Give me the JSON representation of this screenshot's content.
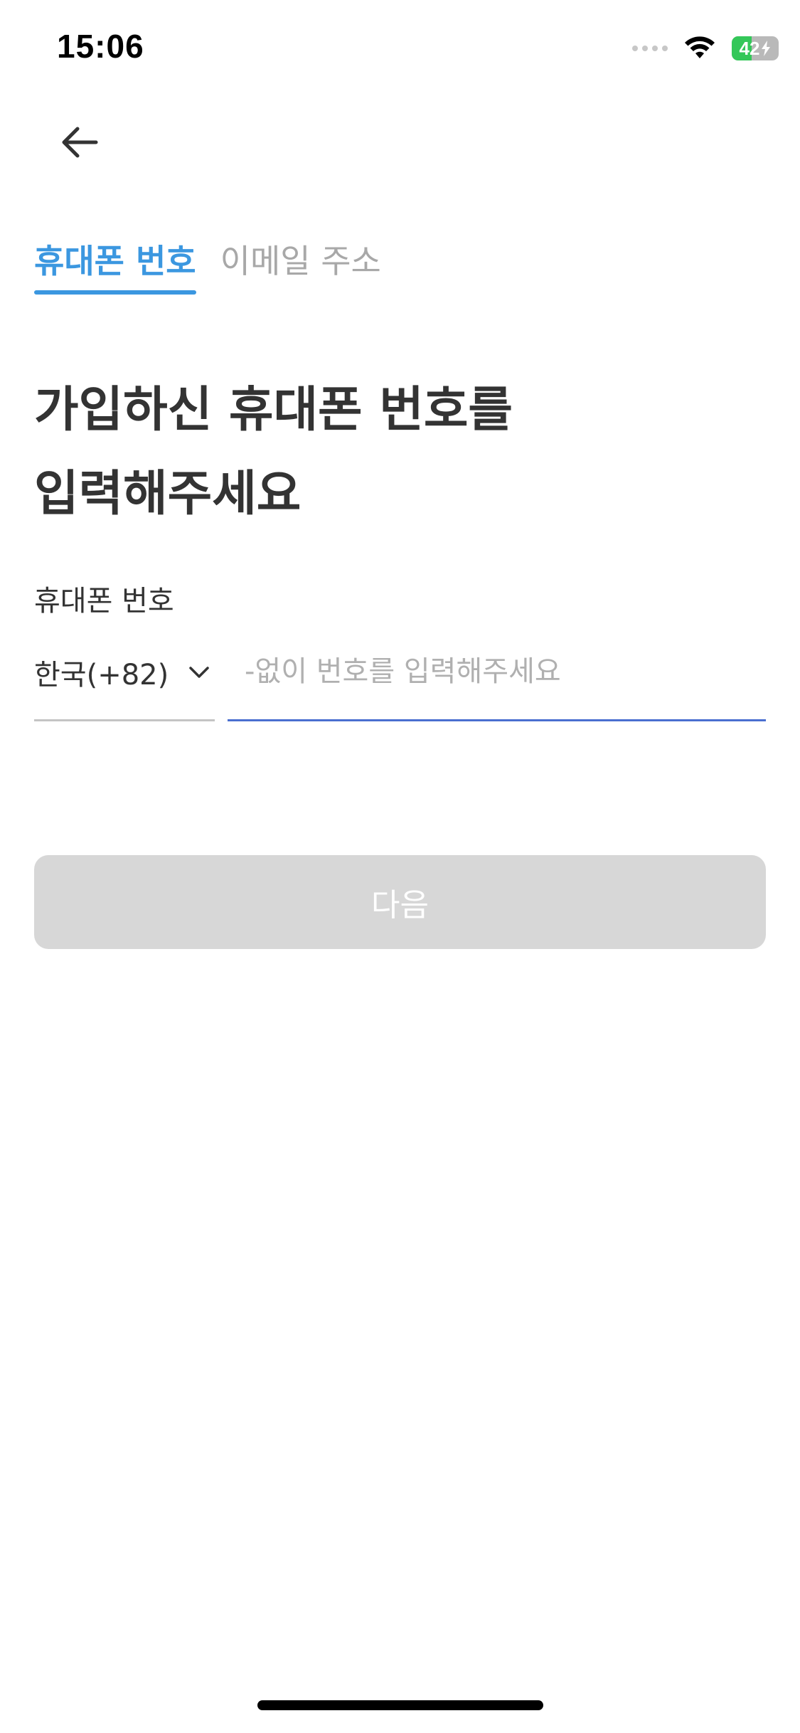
{
  "status_bar": {
    "time": "15:06",
    "battery_percent": "42",
    "battery_level": 0.42,
    "icons": {
      "signal": "cellular-signal-icon",
      "wifi": "wifi-icon",
      "battery": "battery-charging-icon"
    }
  },
  "nav": {
    "back_icon": "arrow-left-icon"
  },
  "tabs": [
    {
      "label": "휴대폰 번호",
      "active": true
    },
    {
      "label": "이메일 주소",
      "active": false
    }
  ],
  "title": {
    "line1": "가입하신 휴대폰 번호를",
    "line2": "입력해주세요"
  },
  "form": {
    "field_label": "휴대폰 번호",
    "country_value": "한국(+82)",
    "country_icon": "chevron-down-icon",
    "phone_value": "",
    "phone_placeholder": "-없이 번호를 입력해주세요"
  },
  "next_button": {
    "label": "다음",
    "enabled": false
  },
  "colors": {
    "accent": "#3b97e0",
    "input_focus": "#4a6fd0",
    "button_disabled": "#d7d7d7",
    "battery_fill": "#34c759"
  }
}
